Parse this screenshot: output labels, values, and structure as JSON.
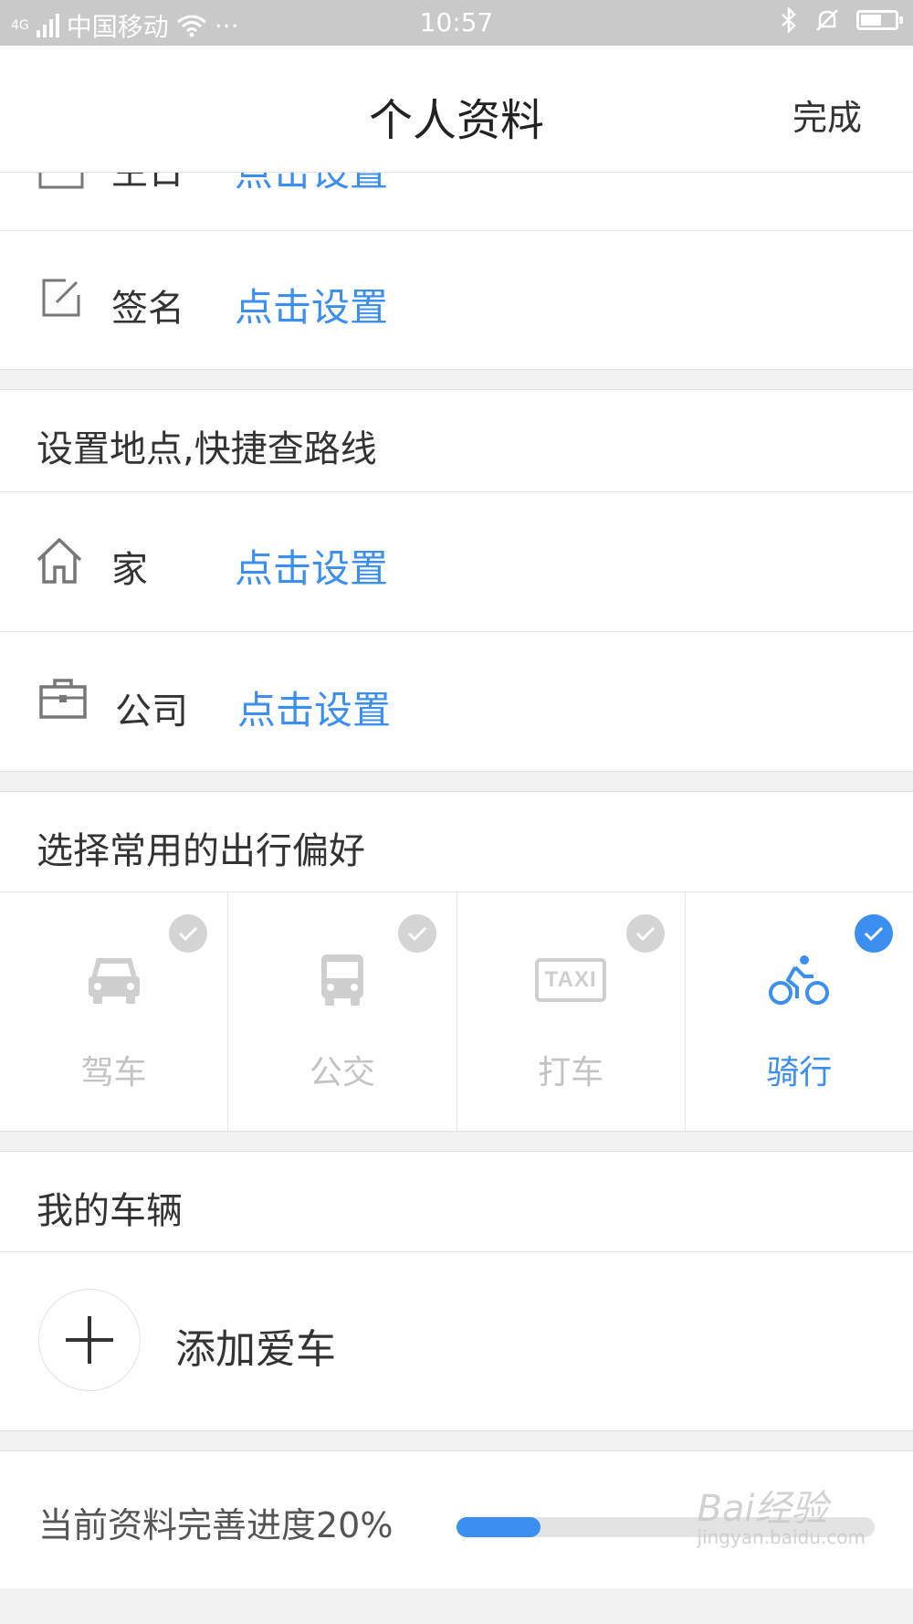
{
  "status_bar": {
    "network": "4G",
    "carrier": "中国移动",
    "more": "···",
    "time": "10:57"
  },
  "header": {
    "title": "个人资料",
    "done_label": "完成"
  },
  "profile": {
    "partial_row": {
      "label": "生日",
      "value": "点击设置",
      "icon": "calendar-icon"
    },
    "signature": {
      "label": "签名",
      "value": "点击设置",
      "icon": "edit-icon"
    }
  },
  "places": {
    "title": "设置地点,快捷查路线",
    "items": [
      {
        "label": "家",
        "value": "点击设置",
        "icon": "home-icon"
      },
      {
        "label": "公司",
        "value": "点击设置",
        "icon": "briefcase-icon"
      }
    ]
  },
  "travel": {
    "title": "选择常用的出行偏好",
    "options": [
      {
        "label": "驾车",
        "icon": "car-icon",
        "selected": false
      },
      {
        "label": "公交",
        "icon": "bus-icon",
        "selected": false
      },
      {
        "label": "打车",
        "icon": "taxi-icon",
        "icon_text": "TAXI",
        "selected": false
      },
      {
        "label": "骑行",
        "icon": "bicycle-icon",
        "selected": true
      }
    ],
    "accent_color": "#3a8ff0",
    "inactive_color": "#c4c4c4"
  },
  "vehicles": {
    "title": "我的车辆",
    "add_label": "添加爱车"
  },
  "progress": {
    "text": "当前资料完善进度20%",
    "value": 0.2
  },
  "watermark": {
    "text": "Bai经验",
    "sub": "jingyan.baidu.com"
  }
}
